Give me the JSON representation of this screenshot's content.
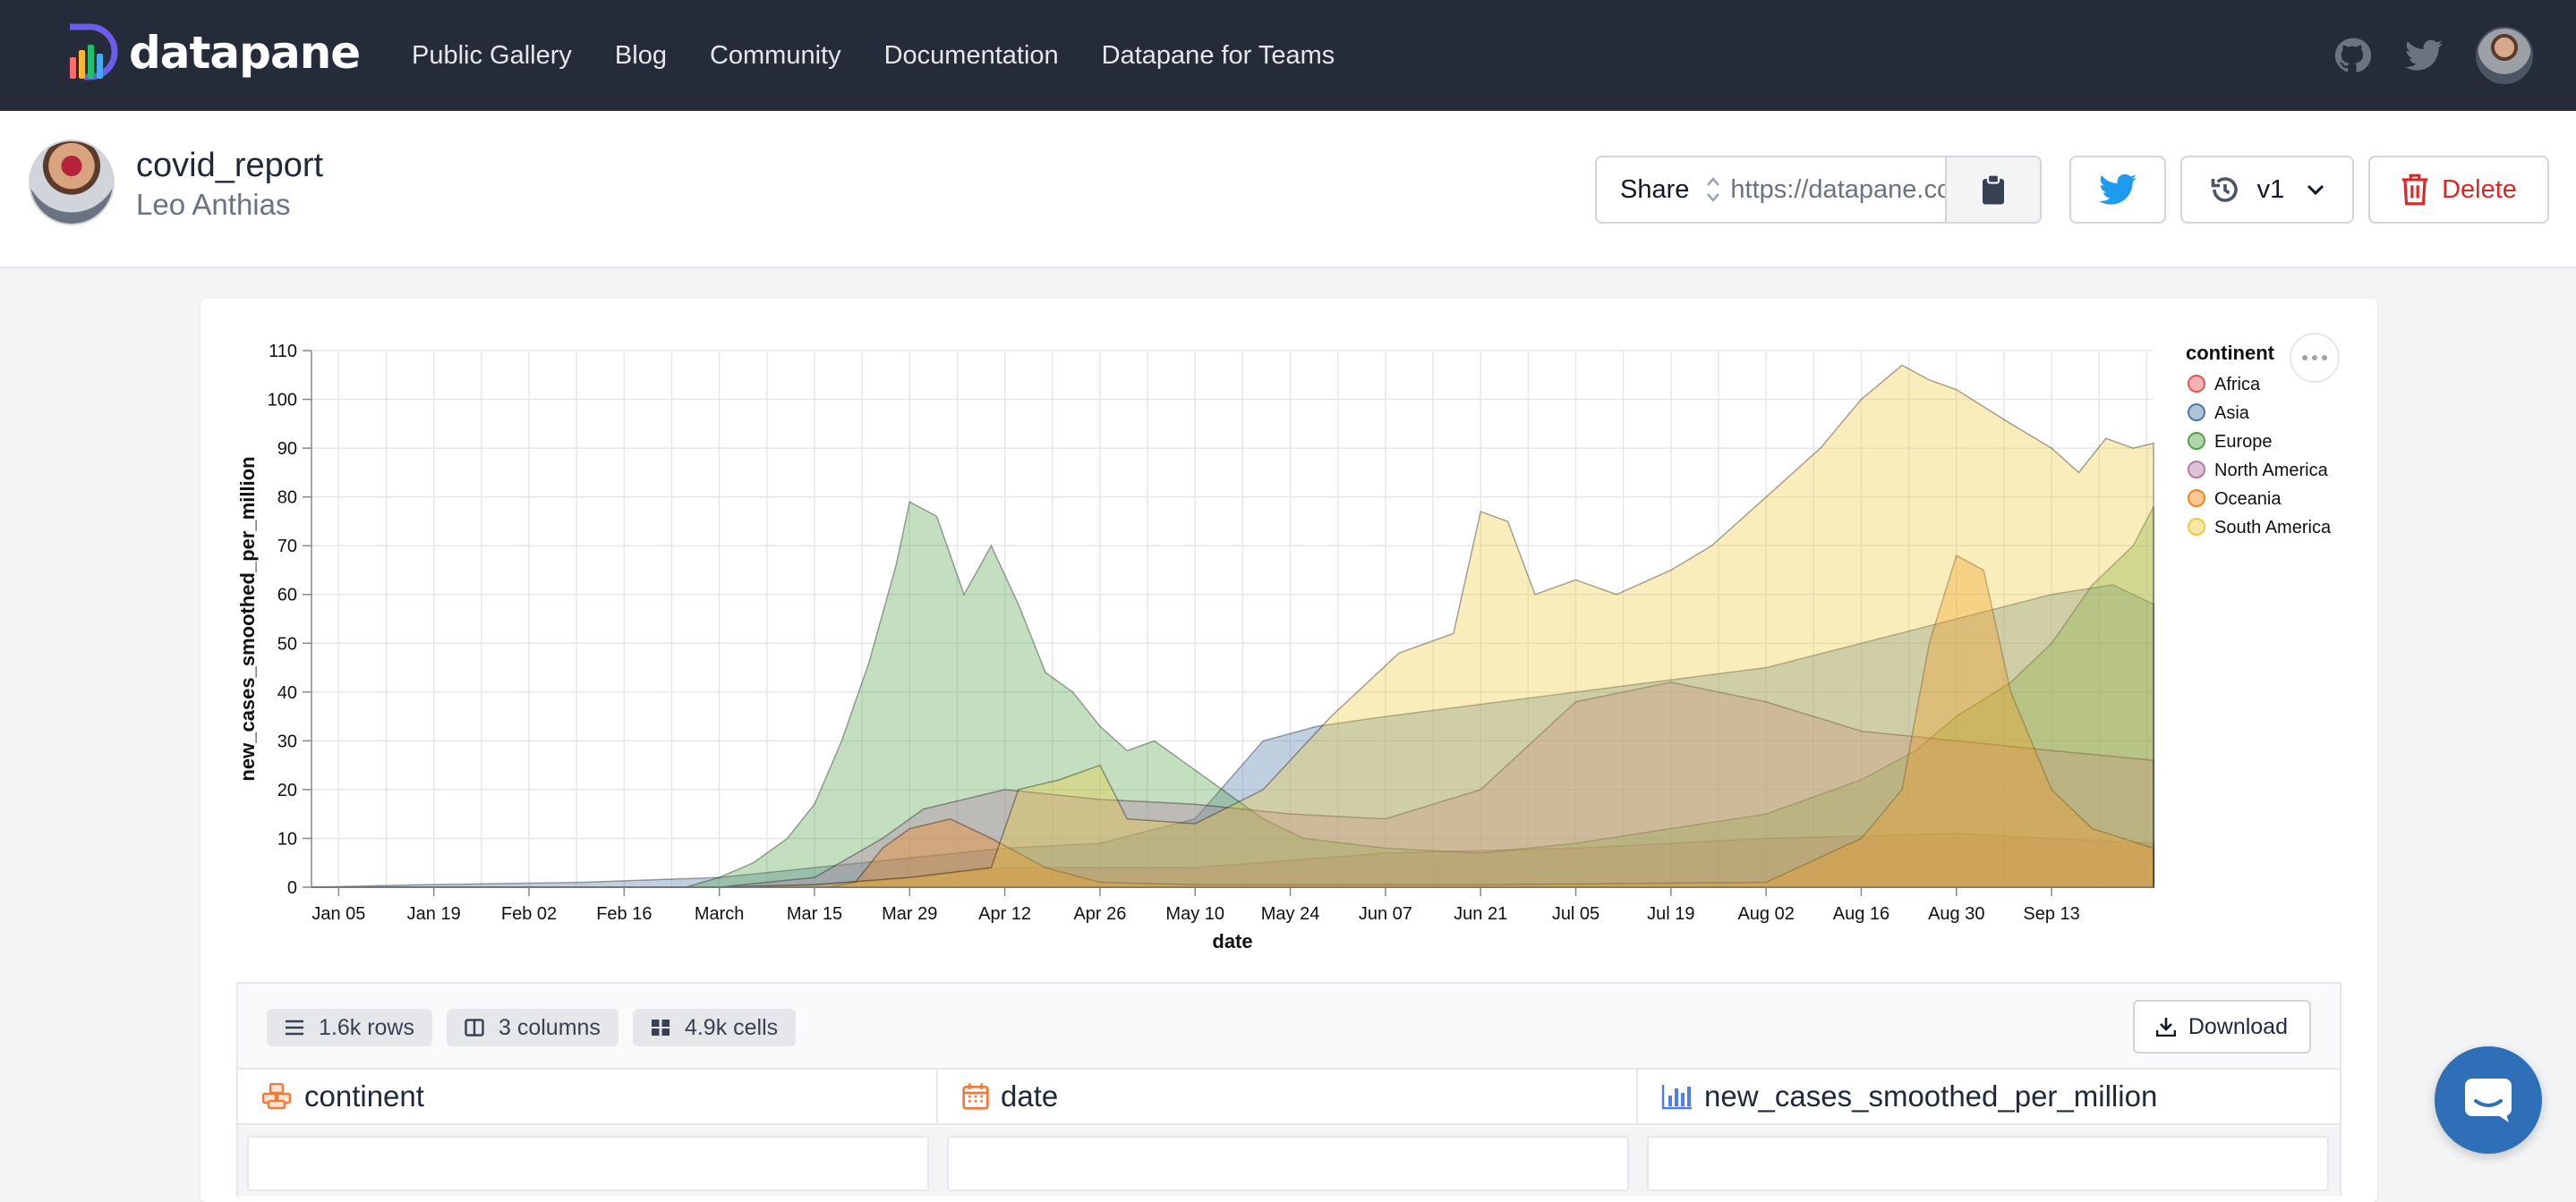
{
  "brand": {
    "name": "datapane"
  },
  "nav": {
    "links": [
      "Public Gallery",
      "Blog",
      "Community",
      "Documentation",
      "Datapane for Teams"
    ]
  },
  "report": {
    "title": "covid_report",
    "author": "Leo Anthias"
  },
  "share": {
    "label": "Share",
    "url": "https://datapane.com/u/leo/reports/covid-report/"
  },
  "version": {
    "label": "v1"
  },
  "delete": {
    "label": "Delete"
  },
  "colors": {
    "nav_bg": "#262b3a",
    "delete": "#dc2626",
    "twitter": "#1d9bf0",
    "chat": "#2f6fb8"
  },
  "chart_data": {
    "type": "area",
    "xlabel": "date",
    "ylabel": "new_cases_smoothed_per_million",
    "ylim": [
      0,
      110
    ],
    "yticks": [
      0,
      10,
      20,
      30,
      40,
      50,
      60,
      70,
      80,
      90,
      100,
      110
    ],
    "xtick_labels": [
      "Jan 05",
      "Jan 19",
      "Feb 02",
      "Feb 16",
      "March",
      "Mar 15",
      "Mar 29",
      "Apr 12",
      "Apr 26",
      "May 10",
      "May 24",
      "Jun 07",
      "Jun 21",
      "Jul 05",
      "Jul 19",
      "Aug 02",
      "Aug 16",
      "Aug 30",
      "Sep 13"
    ],
    "xtick_days": [
      4,
      18,
      32,
      46,
      60,
      74,
      88,
      102,
      116,
      130,
      144,
      158,
      172,
      186,
      200,
      214,
      228,
      242,
      256
    ],
    "xlim_days": [
      0,
      271
    ],
    "grid": true,
    "legend": {
      "title": "continent",
      "placement": "right"
    },
    "series": [
      {
        "name": "Africa",
        "color": "#e45756",
        "points": [
          [
            0,
            0
          ],
          [
            60,
            0
          ],
          [
            74,
            0.5
          ],
          [
            88,
            2
          ],
          [
            102,
            4
          ],
          [
            130,
            4
          ],
          [
            158,
            7
          ],
          [
            186,
            8
          ],
          [
            214,
            10
          ],
          [
            242,
            11
          ],
          [
            256,
            10
          ],
          [
            271,
            9
          ]
        ]
      },
      {
        "name": "Asia",
        "color": "#4c78a8",
        "points": [
          [
            0,
            0
          ],
          [
            16,
            0.5
          ],
          [
            40,
            1
          ],
          [
            60,
            2
          ],
          [
            74,
            4
          ],
          [
            88,
            6
          ],
          [
            102,
            8
          ],
          [
            116,
            9
          ],
          [
            130,
            14
          ],
          [
            140,
            30
          ],
          [
            148,
            33
          ],
          [
            158,
            35
          ],
          [
            186,
            40
          ],
          [
            214,
            45
          ],
          [
            242,
            55
          ],
          [
            256,
            60
          ],
          [
            265,
            62
          ],
          [
            271,
            58
          ]
        ]
      },
      {
        "name": "Europe",
        "color": "#54a24b",
        "points": [
          [
            0,
            0
          ],
          [
            55,
            0
          ],
          [
            60,
            2
          ],
          [
            65,
            5
          ],
          [
            70,
            10
          ],
          [
            74,
            17
          ],
          [
            78,
            30
          ],
          [
            82,
            46
          ],
          [
            86,
            66
          ],
          [
            88,
            79
          ],
          [
            92,
            76
          ],
          [
            96,
            60
          ],
          [
            100,
            70
          ],
          [
            104,
            58
          ],
          [
            108,
            44
          ],
          [
            112,
            40
          ],
          [
            116,
            33
          ],
          [
            120,
            28
          ],
          [
            124,
            30
          ],
          [
            128,
            26
          ],
          [
            132,
            22
          ],
          [
            136,
            18
          ],
          [
            140,
            14
          ],
          [
            146,
            10
          ],
          [
            152,
            9
          ],
          [
            158,
            8
          ],
          [
            172,
            7
          ],
          [
            186,
            9
          ],
          [
            200,
            12
          ],
          [
            214,
            15
          ],
          [
            228,
            22
          ],
          [
            236,
            28
          ],
          [
            242,
            35
          ],
          [
            250,
            42
          ],
          [
            256,
            50
          ],
          [
            262,
            62
          ],
          [
            268,
            70
          ],
          [
            271,
            78
          ]
        ]
      },
      {
        "name": "North America",
        "color": "#b279a2",
        "points": [
          [
            0,
            0
          ],
          [
            60,
            0
          ],
          [
            74,
            2
          ],
          [
            84,
            10
          ],
          [
            90,
            16
          ],
          [
            96,
            18
          ],
          [
            102,
            20
          ],
          [
            116,
            18
          ],
          [
            130,
            17
          ],
          [
            144,
            15
          ],
          [
            158,
            14
          ],
          [
            172,
            20
          ],
          [
            186,
            38
          ],
          [
            200,
            42
          ],
          [
            214,
            38
          ],
          [
            228,
            32
          ],
          [
            242,
            30
          ],
          [
            256,
            28
          ],
          [
            271,
            26
          ]
        ]
      },
      {
        "name": "Oceania",
        "color": "#f58518",
        "points": [
          [
            0,
            0
          ],
          [
            76,
            0
          ],
          [
            80,
            1
          ],
          [
            84,
            8
          ],
          [
            88,
            12
          ],
          [
            94,
            14
          ],
          [
            100,
            10
          ],
          [
            108,
            4
          ],
          [
            116,
            1
          ],
          [
            130,
            0.5
          ],
          [
            172,
            0.5
          ],
          [
            214,
            1
          ],
          [
            228,
            10
          ],
          [
            234,
            20
          ],
          [
            238,
            50
          ],
          [
            242,
            68
          ],
          [
            246,
            65
          ],
          [
            250,
            40
          ],
          [
            256,
            20
          ],
          [
            262,
            12
          ],
          [
            271,
            8
          ]
        ]
      },
      {
        "name": "South America",
        "color": "#eeca3b",
        "points": [
          [
            0,
            0
          ],
          [
            60,
            0
          ],
          [
            74,
            0.5
          ],
          [
            88,
            2
          ],
          [
            100,
            4
          ],
          [
            104,
            20
          ],
          [
            110,
            22
          ],
          [
            116,
            25
          ],
          [
            120,
            14
          ],
          [
            130,
            13
          ],
          [
            140,
            20
          ],
          [
            150,
            35
          ],
          [
            160,
            48
          ],
          [
            168,
            52
          ],
          [
            172,
            77
          ],
          [
            176,
            75
          ],
          [
            180,
            60
          ],
          [
            186,
            63
          ],
          [
            192,
            60
          ],
          [
            200,
            65
          ],
          [
            206,
            70
          ],
          [
            214,
            80
          ],
          [
            222,
            90
          ],
          [
            228,
            100
          ],
          [
            234,
            107
          ],
          [
            238,
            104
          ],
          [
            242,
            102
          ],
          [
            250,
            95
          ],
          [
            256,
            90
          ],
          [
            260,
            85
          ],
          [
            264,
            92
          ],
          [
            268,
            90
          ],
          [
            271,
            91
          ]
        ]
      }
    ]
  },
  "table": {
    "rows_label": "1.6k rows",
    "columns_label": "3 columns",
    "cells_label": "4.9k cells",
    "download_label": "Download",
    "columns": [
      "continent",
      "date",
      "new_cases_smoothed_per_million"
    ]
  }
}
